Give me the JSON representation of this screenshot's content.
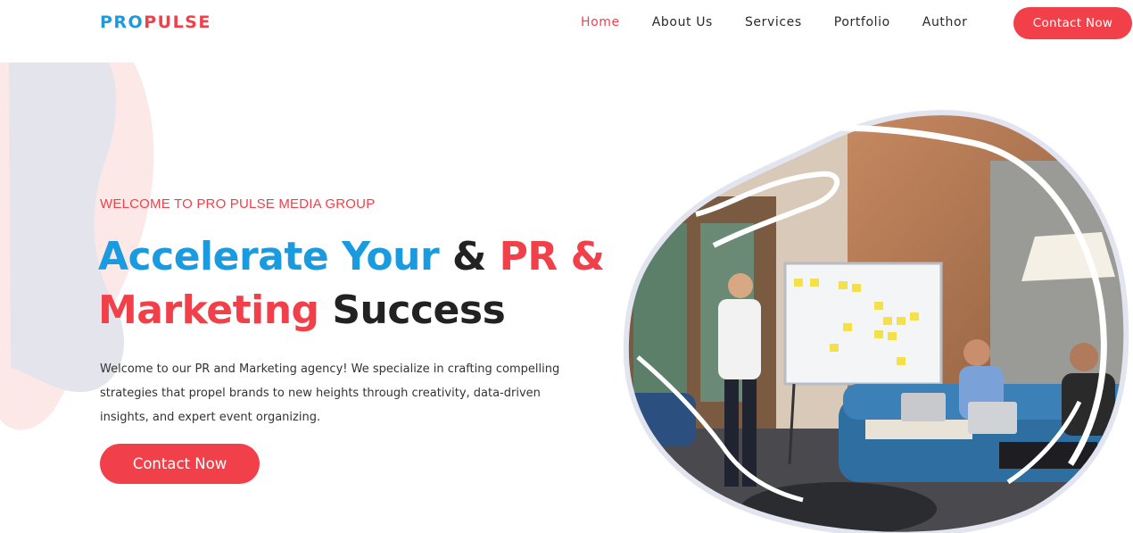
{
  "header": {
    "logo_part1": "PRO",
    "logo_part2": "PULSE",
    "nav": [
      "Home",
      "About Us",
      "Services",
      "Portfolio",
      "Author"
    ],
    "active_nav": "Home",
    "contact_label": "Contact Now"
  },
  "hero": {
    "eyebrow": "WELCOME TO PRO PULSE MEDIA GROUP",
    "headline_part1": "Accelerate Your",
    "headline_part2": " & ",
    "headline_part3": "PR &",
    "headline_part4": "Marketing",
    "headline_part5": " Success",
    "description": "Welcome to our PR and Marketing agency! We specialize in crafting compelling strategies that propel brands to new heights through creativity, data-driven insights, and expert event organizing.",
    "contact_label": "Contact Now"
  },
  "colors": {
    "brand_blue": "#1a9be0",
    "brand_red": "#f2404a",
    "text_dark": "#222222",
    "deco_gray": "#e4e4ec",
    "deco_pink": "#fde8e8"
  }
}
